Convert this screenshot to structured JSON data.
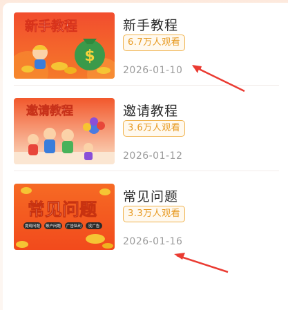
{
  "items": [
    {
      "thumb_text": "新手教程",
      "title": "新手教程",
      "views": "6.7万人观看",
      "date": "2026-01-10"
    },
    {
      "thumb_text": "邀请教程",
      "title": "邀请教程",
      "views": "3.6万人观看",
      "date": "2026-01-12"
    },
    {
      "thumb_text": "常见问题",
      "thumb_tags": [
        "提现问题",
        "账户问题",
        "广告私利",
        "没广告"
      ],
      "title": "常见问题",
      "views": "3.3万人观看",
      "date": "2026-01-16"
    }
  ],
  "colors": {
    "accent_orange": "#e79a22",
    "badge_border": "#f0b24c",
    "annotation_arrow": "#ea3b32",
    "thumb_red": "#f0442a"
  },
  "icons": [
    "money-bag-icon",
    "coin-icon",
    "cartoon-character-icon",
    "arrow-annotation-icon"
  ]
}
